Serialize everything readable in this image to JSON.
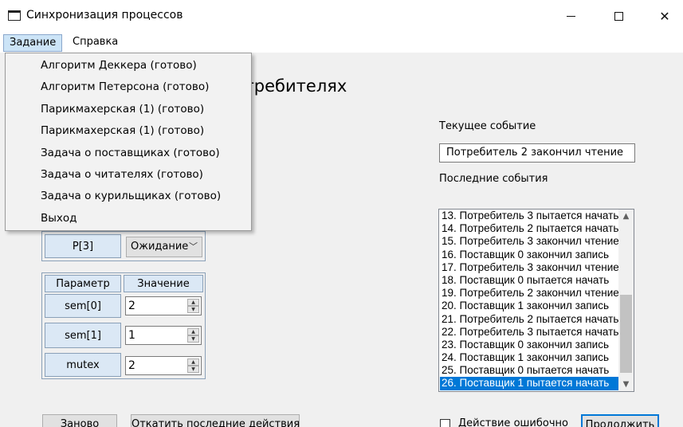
{
  "window": {
    "title": "Синхронизация процессов",
    "controls": {
      "minimize": "—",
      "maximize": "☐",
      "close": "✕"
    }
  },
  "menubar": {
    "items": [
      {
        "label": "Задание"
      },
      {
        "label": "Справка"
      }
    ]
  },
  "dropdown": {
    "items": [
      "Алгоритм Деккера (готово)",
      "Алгоритм Петерсона (готово)",
      "Парикмахерская (1) (готово)",
      "Парикмахерская (1) (готово)",
      "Задача о поставщиках (готово)",
      "Задача о читателях (готово)",
      "Задача о курильщиках (готово)",
      "Выход"
    ]
  },
  "main": {
    "heading": "потребителях"
  },
  "right_panel": {
    "current_event_label": "Текущее событие",
    "current_event_value": "Потребитель 2 закончил чтение",
    "recent_events_label": "Последние события",
    "events": [
      "13. Потребитель 3 пытается начать",
      "14. Потребитель 2 пытается начать",
      "15. Потребитель 3 закончил чтение",
      "16. Поставщик 0 закончил запись",
      "17. Потребитель 3 закончил чтение",
      "18. Поставщик 0 пытается начать",
      "19. Потребитель 2 закончил чтение",
      "20. Поставщик 1 закончил запись",
      "21. Потребитель 2 пытается начать",
      "22. Потребитель 3 пытается начать",
      "23. Поставщик 0 закончил запись",
      "24. Поставщик 1 закончил запись",
      "25. Поставщик 0 пытается начать",
      "26. Поставщик 1 пытается начать"
    ],
    "selected_index": 13
  },
  "process_table": {
    "row_label": "P[3]",
    "state_value": "Ожидание"
  },
  "params_table": {
    "header_param": "Параметр",
    "header_value": "Значение",
    "rows": [
      {
        "name": "sem[0]",
        "value": "2"
      },
      {
        "name": "sem[1]",
        "value": "1"
      },
      {
        "name": "mutex",
        "value": "2"
      }
    ]
  },
  "bottom": {
    "restart_label": "Заново",
    "rollback_label": "Откатить последние действия",
    "wrong_action_label": "Действие ошибочно",
    "continue_label": "Продолжить"
  },
  "colors": {
    "accent": "#0078d7",
    "cell_bg": "#dbe8f5"
  }
}
